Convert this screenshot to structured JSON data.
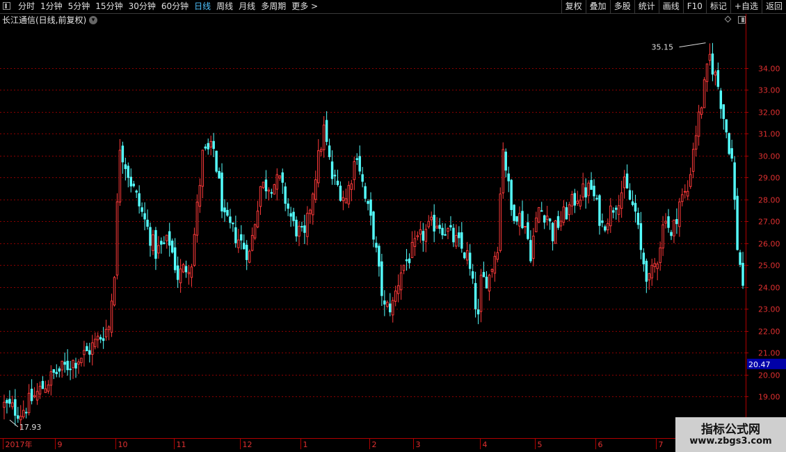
{
  "toolbar": {
    "periods": [
      "分时",
      "1分钟",
      "5分钟",
      "15分钟",
      "30分钟",
      "60分钟",
      "日线",
      "周线",
      "月线",
      "多周期",
      "更多 >"
    ],
    "active_index": 6,
    "tools": [
      "复权",
      "叠加",
      "多股",
      "统计",
      "画线",
      "F10",
      "标记",
      "+自选",
      "返回"
    ]
  },
  "header": {
    "title": "长江通信(日线,前复权)"
  },
  "colors": {
    "up": "#ff3a3a",
    "down": "#54ffff",
    "highlight": "#ff3cff",
    "grid": "#8b0000",
    "axis": "#b00000",
    "price_tag": "#0000a8"
  },
  "watermark": {
    "title": "指标公式网",
    "url": "www.zbgs3.com"
  },
  "chart_data": {
    "type": "candlestick",
    "title": "长江通信(日线,前复权)",
    "y_ticks": [
      19.0,
      20.0,
      21.0,
      22.0,
      23.0,
      24.0,
      25.0,
      26.0,
      27.0,
      28.0,
      29.0,
      30.0,
      31.0,
      32.0,
      33.0,
      34.0
    ],
    "ylim": [
      17.1,
      35.9
    ],
    "x_month_labels": [
      "2017年",
      "9",
      "10",
      "11",
      "12",
      "1",
      "2",
      "3",
      "4",
      "5",
      "6",
      "7"
    ],
    "x_month_start_index": [
      0,
      19,
      41,
      62,
      86,
      108,
      133,
      149,
      173,
      193,
      215,
      237
    ],
    "max_marker": {
      "value": 35.15,
      "label": "35.15"
    },
    "min_marker": {
      "value": 17.93,
      "label": "17.93"
    },
    "current_price": {
      "value": 20.47,
      "label": "20.47"
    },
    "keypoints": [
      [
        0,
        18.6
      ],
      [
        6,
        18.3
      ],
      [
        18,
        20.0
      ],
      [
        30,
        21.0
      ],
      [
        38,
        22.2
      ],
      [
        40,
        24.8
      ],
      [
        42,
        30.5
      ],
      [
        46,
        28.8
      ],
      [
        55,
        25.6
      ],
      [
        60,
        26.1
      ],
      [
        63,
        24.5
      ],
      [
        68,
        25.2
      ],
      [
        72,
        30.0
      ],
      [
        76,
        30.3
      ],
      [
        80,
        27.0
      ],
      [
        85,
        26.2
      ],
      [
        89,
        25.5
      ],
      [
        93,
        28.6
      ],
      [
        100,
        28.8
      ],
      [
        105,
        26.8
      ],
      [
        109,
        26.2
      ],
      [
        113,
        29.2
      ],
      [
        116,
        31.2
      ],
      [
        119,
        29.0
      ],
      [
        124,
        28.0
      ],
      [
        128,
        30.2
      ],
      [
        131,
        28.0
      ],
      [
        134,
        26.5
      ],
      [
        136,
        24.6
      ],
      [
        138,
        23.0
      ],
      [
        141,
        23.2
      ],
      [
        144,
        24.8
      ],
      [
        148,
        25.6
      ],
      [
        152,
        26.4
      ],
      [
        157,
        27.0
      ],
      [
        161,
        26.5
      ],
      [
        165,
        25.9
      ],
      [
        168,
        25.4
      ],
      [
        170,
        24.0
      ],
      [
        172,
        22.5
      ],
      [
        173,
        24.2
      ],
      [
        176,
        24.5
      ],
      [
        179,
        26.0
      ],
      [
        181,
        30.5
      ],
      [
        184,
        27.5
      ],
      [
        186,
        27.4
      ],
      [
        189,
        26.8
      ],
      [
        191,
        25.6
      ],
      [
        194,
        27.6
      ],
      [
        197,
        27.3
      ],
      [
        199,
        26.4
      ],
      [
        201,
        26.9
      ],
      [
        205,
        27.6
      ],
      [
        208,
        28.2
      ],
      [
        213,
        28.5
      ],
      [
        217,
        26.8
      ],
      [
        221,
        27.7
      ],
      [
        225,
        28.6
      ],
      [
        229,
        27.4
      ],
      [
        231,
        25.6
      ],
      [
        234,
        24.2
      ],
      [
        237,
        25.4
      ],
      [
        240,
        27.4
      ],
      [
        242,
        26.2
      ],
      [
        245,
        27.9
      ],
      [
        248,
        28.4
      ],
      [
        250,
        30.4
      ],
      [
        253,
        32.4
      ],
      [
        256,
        34.5
      ],
      [
        259,
        33.2
      ],
      [
        261,
        31.8
      ],
      [
        264,
        29.8
      ],
      [
        266,
        25.9
      ],
      [
        268,
        24.2
      ]
    ]
  }
}
